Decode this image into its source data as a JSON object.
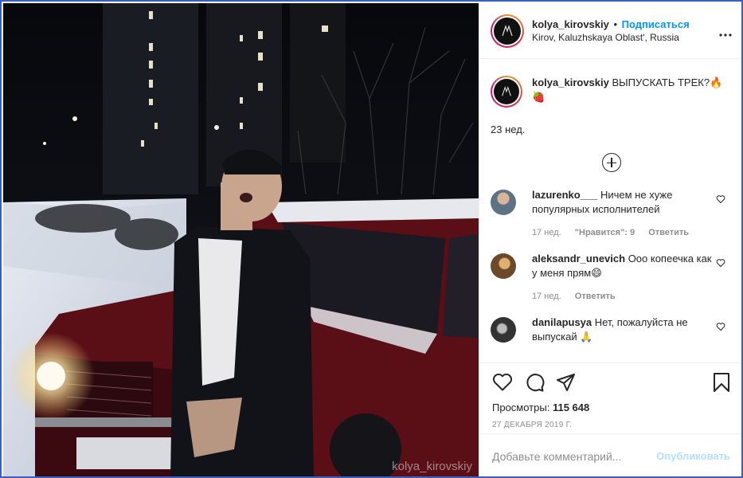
{
  "media": {
    "watermark": "kolya_kirovskiy"
  },
  "header": {
    "username": "kolya_kirovskiy",
    "separator": "•",
    "follow_label": "Подписаться",
    "location": "Kirov, Kaluzhskaya Oblast', Russia",
    "more_icon": "more-horizontal-icon"
  },
  "caption": {
    "username": "kolya_kirovskiy",
    "text": "ВЫПУСКАТЬ ТРЕК?🔥🍓",
    "time": "23 нед."
  },
  "comments": [
    {
      "username": "lazurenko___",
      "text": "Ничем не хуже популярных исполнителей",
      "time": "17 нед.",
      "likes": "\"Нравится\": 9",
      "reply": "Ответить",
      "avatar_color": "#6b7f8e"
    },
    {
      "username": "aleksandr_unevich",
      "text": "Ооо копеечка как у меня прям😄",
      "time": "17 нед.",
      "reply": "Ответить",
      "avatar_color": "#b07a3a"
    },
    {
      "username": "danilapusya",
      "text": "Нет, пожалуйста не выпускай 🙏",
      "time": "",
      "reply": "",
      "avatar_color": "#4a4a4a"
    }
  ],
  "stats": {
    "views_label": "Просмотры:",
    "views_value": "115 648",
    "date": "27 ДЕКАБРЯ 2019 Г."
  },
  "add_comment": {
    "placeholder": "Добавьте комментарий...",
    "post_label": "Опубликовать"
  },
  "colors": {
    "accent": "#0095f6",
    "post_disabled": "#b2dffc",
    "frame": "#3b5fc0"
  }
}
